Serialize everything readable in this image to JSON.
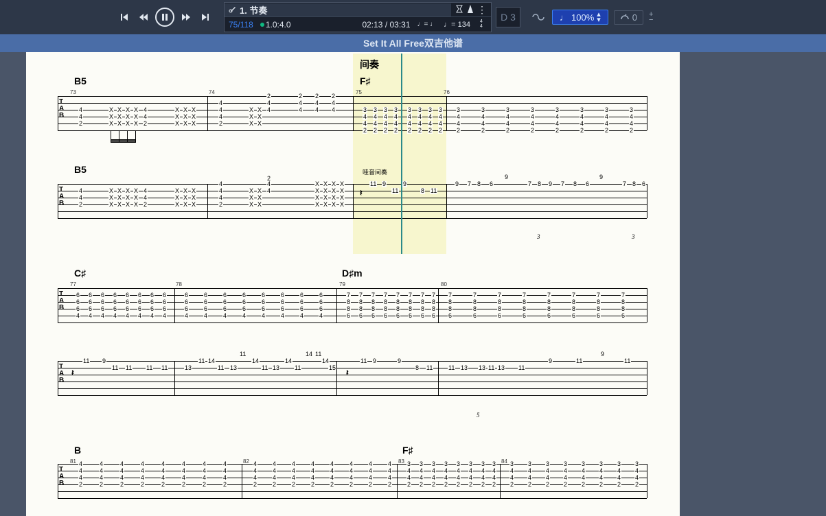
{
  "toolbar": {
    "track_name": "1. 节奏",
    "bar_position": "75/118",
    "relative_speed": "1.0:4.0",
    "time_current": "02:13",
    "time_total": "03:31",
    "tempo_note_equals_note": "♩= ♩",
    "tempo_value": "♩= 134",
    "key": "D 3",
    "zoom": "100%",
    "speed": "0"
  },
  "title": "Set It All Free双吉他谱",
  "sections": {
    "interlude": "间奏",
    "wah_interlude": "哇音间奏"
  },
  "chords": {
    "B5_1": "B5",
    "F_sharp_1": "F♯",
    "B5_2": "B5",
    "C_sharp": "C♯",
    "D_sharp_m": "D♯m",
    "B": "B",
    "F_sharp_2": "F♯"
  },
  "measures": {
    "m73": "73",
    "m74": "74",
    "m75": "75",
    "m76": "76",
    "m77": "77",
    "m78": "78",
    "m79": "79",
    "m80": "80",
    "m81": "81",
    "m82": "82",
    "m83": "83",
    "m84": "84"
  },
  "tab_letters": {
    "T": "T",
    "A": "A",
    "B": "B"
  },
  "tuplets": {
    "t3": "3",
    "t5": "5"
  },
  "rest_symbol": "𝄽"
}
